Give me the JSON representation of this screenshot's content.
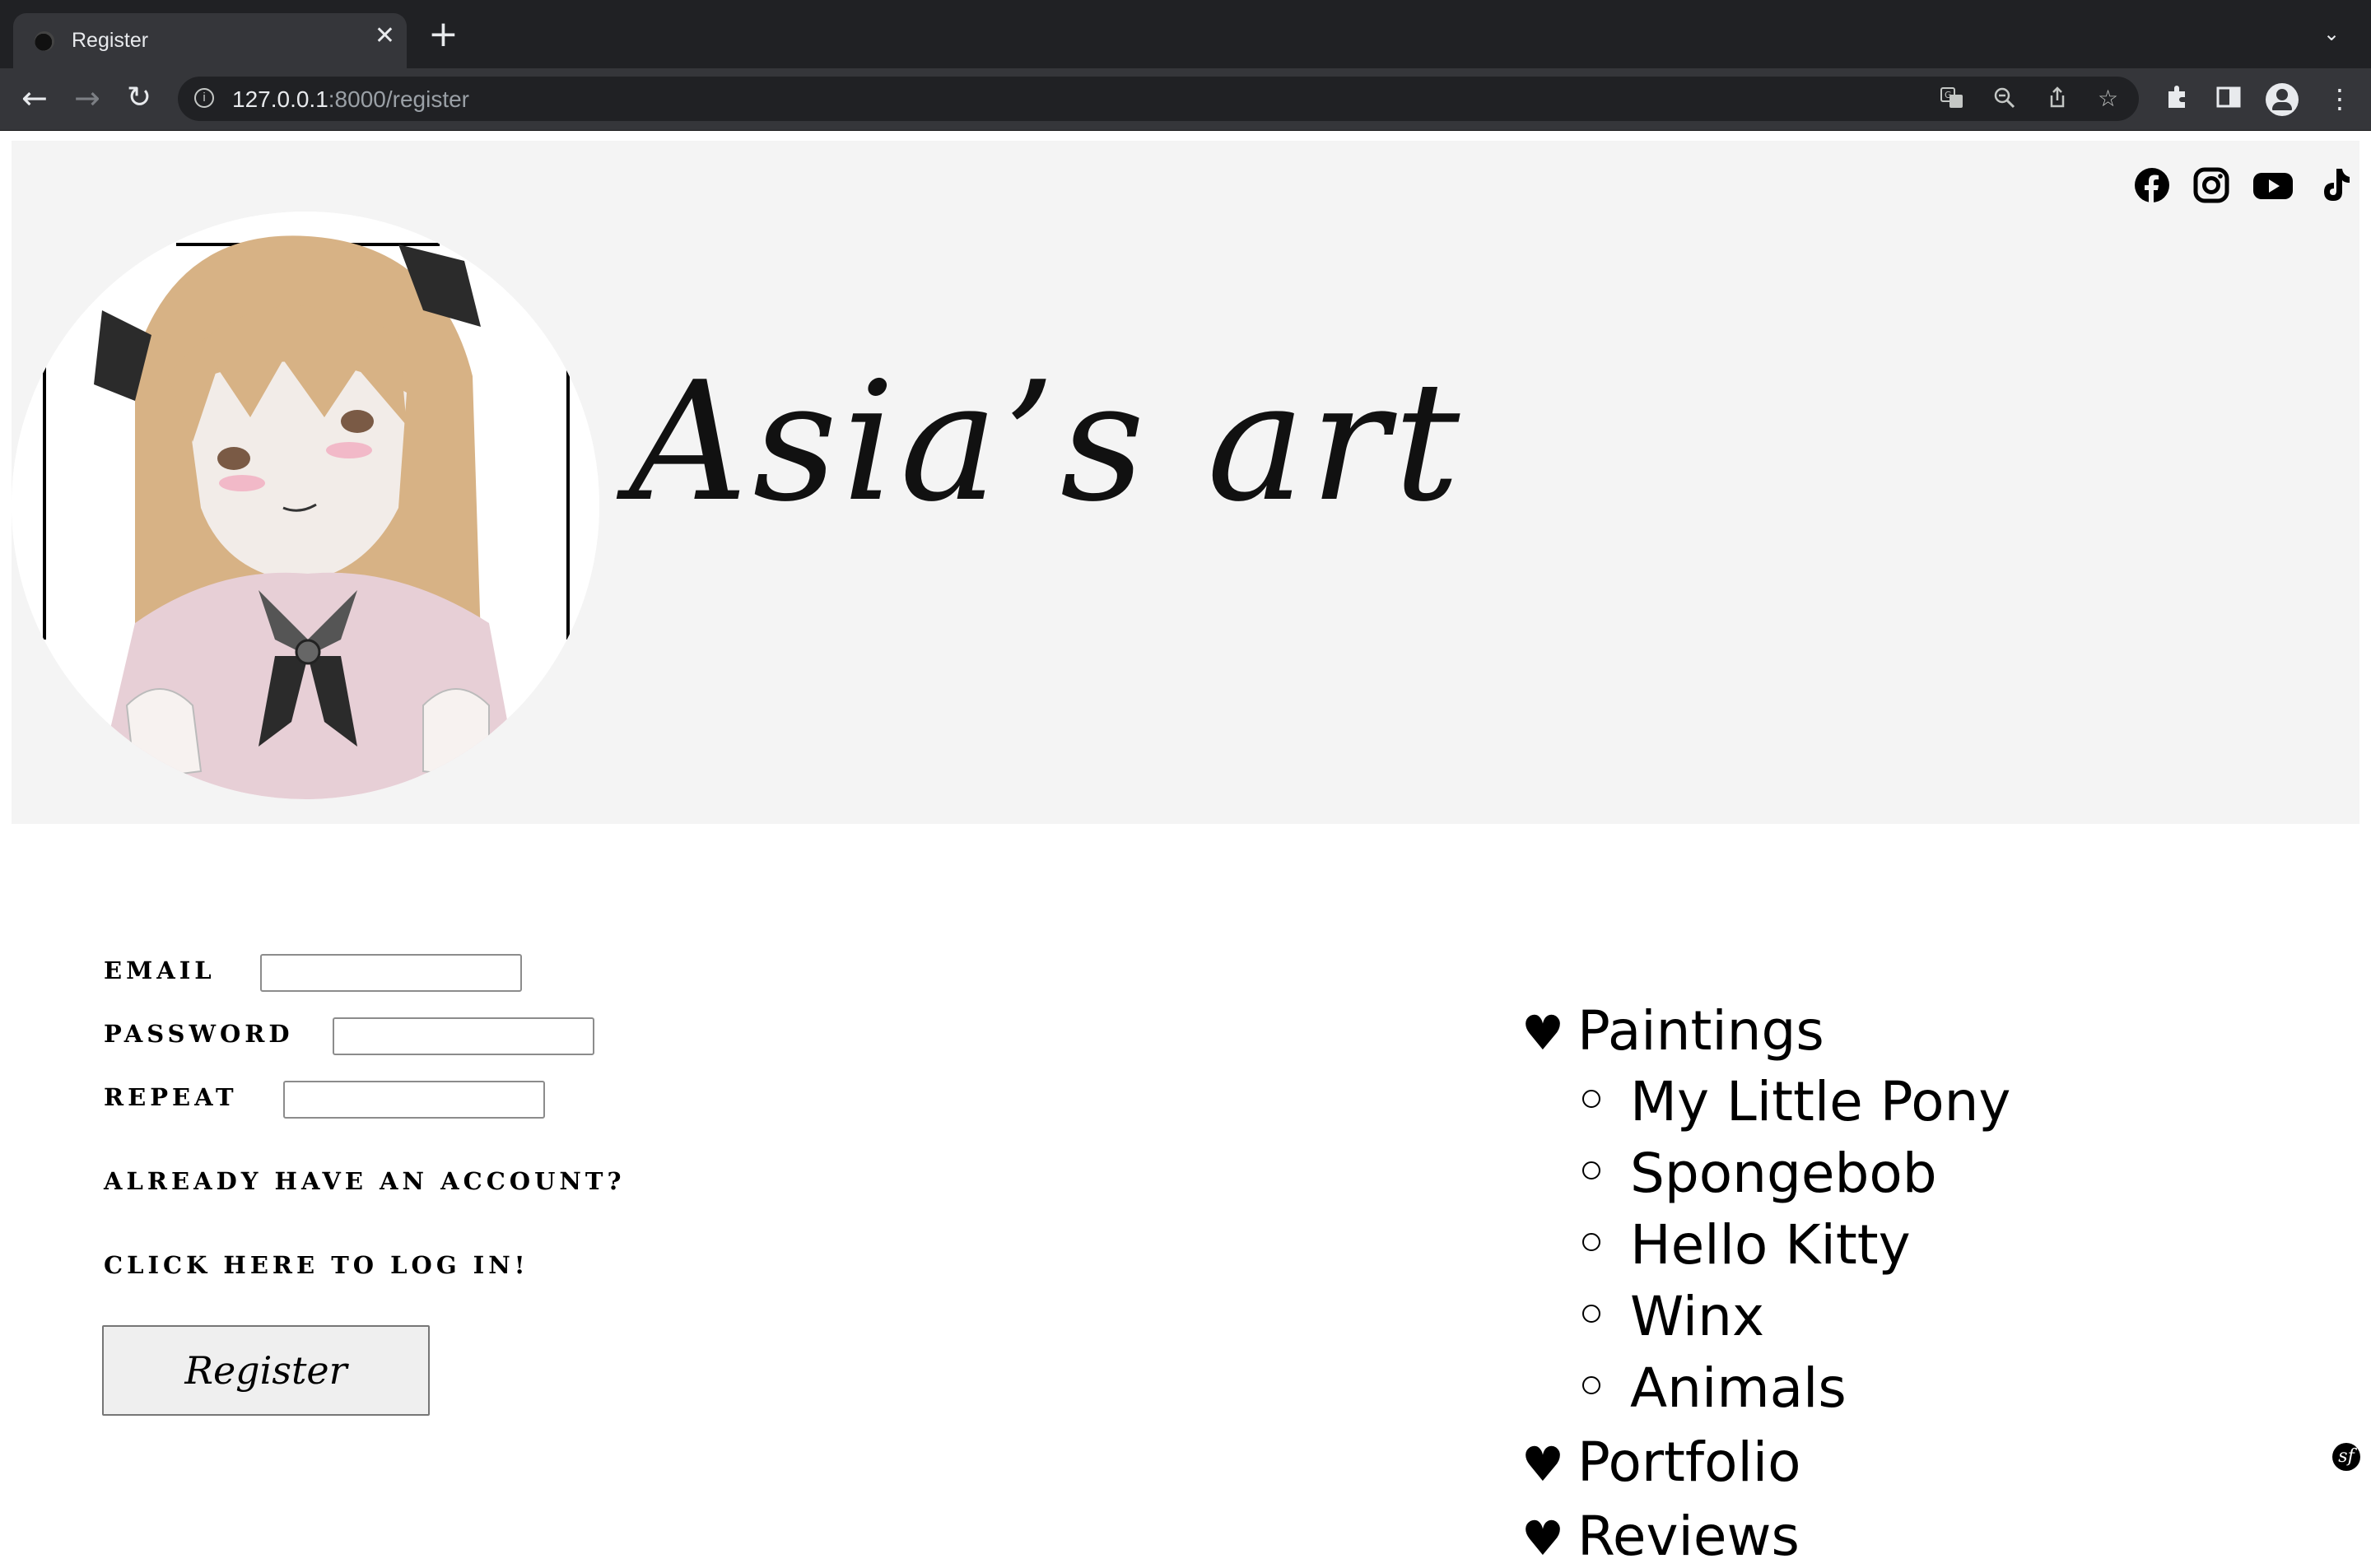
{
  "browser": {
    "tab_title": "Register",
    "url_host": "127.0.0.1",
    "url_rest": ":8000/register"
  },
  "header": {
    "site_title": "Asia’s art",
    "social_icons": [
      "facebook-icon",
      "instagram-icon",
      "youtube-icon",
      "tiktok-icon"
    ]
  },
  "form": {
    "email_label": "Email",
    "password_label": "Password",
    "repeat_label": "Repeat",
    "email_value": "",
    "password_value": "",
    "repeat_value": "",
    "already_text": "Already have an account?",
    "login_link": "Click here to log in!",
    "register_button": "Register"
  },
  "menu": {
    "bullet": "♥",
    "items": [
      {
        "label": "Paintings",
        "children": [
          "My Little Pony",
          "Spongebob",
          "Hello Kitty",
          "Winx",
          "Animals"
        ]
      },
      {
        "label": "Portfolio"
      },
      {
        "label": "Reviews"
      }
    ]
  },
  "colors": {
    "header_bg": "#f4f4f4",
    "browser_dark": "#202124",
    "browser_toolbar": "#35363a"
  }
}
